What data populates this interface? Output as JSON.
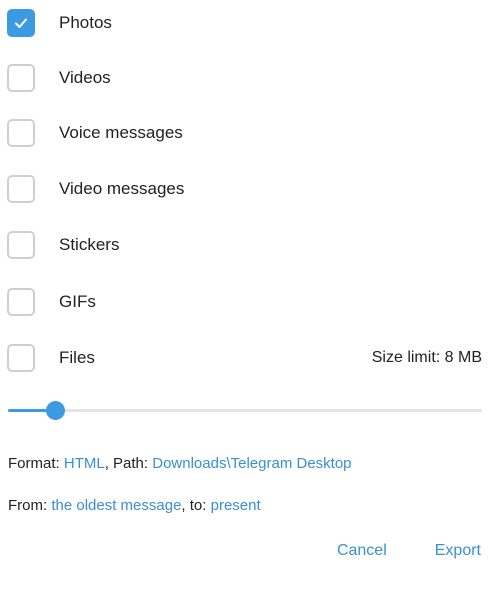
{
  "options": [
    {
      "label": "Photos",
      "checked": true
    },
    {
      "label": "Videos",
      "checked": false
    },
    {
      "label": "Voice messages",
      "checked": false
    },
    {
      "label": "Video messages",
      "checked": false
    },
    {
      "label": "Stickers",
      "checked": false
    },
    {
      "label": "GIFs",
      "checked": false
    },
    {
      "label": "Files",
      "checked": false
    }
  ],
  "size_limit": "Size limit: 8 MB",
  "size_slider": {
    "level": 0.1
  },
  "format_line": {
    "format_label": "Format:",
    "format_value": "HTML",
    "separator": ",",
    "path_label": "Path:",
    "path_value": "Downloads\\Telegram Desktop"
  },
  "range_line": {
    "from_label": "From:",
    "from_value": "the oldest message",
    "separator": ",",
    "to_label": "to:",
    "to_value": "present"
  },
  "buttons": {
    "cancel": "Cancel",
    "export": "Export"
  },
  "colors": {
    "accent": "#3b9ae1",
    "link": "#3a8fd0",
    "checkbox_border": "#cfcfcf",
    "text": "#222222"
  },
  "icons": {
    "checkmark": "checkmark-icon"
  }
}
